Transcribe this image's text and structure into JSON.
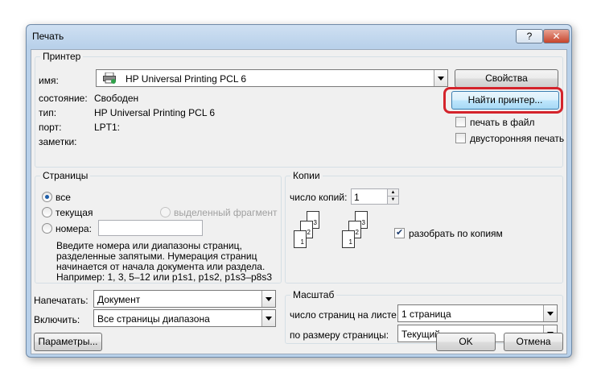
{
  "window": {
    "title": "Печать",
    "help_label": "?",
    "close_label": "✕"
  },
  "printer": {
    "group_title": "Принтер",
    "name_label": "имя:",
    "name_value": "HP Universal Printing PCL 6",
    "status_label": "состояние:",
    "status_value": "Свободен",
    "type_label": "тип:",
    "type_value": "HP Universal Printing PCL 6",
    "port_label": "порт:",
    "port_value": "LPT1:",
    "notes_label": "заметки:",
    "properties_button": "Свойства",
    "find_printer_button": "Найти принтер...",
    "print_to_file_label": "печать в файл",
    "print_to_file_checked": false,
    "duplex_label": "двусторонняя печать",
    "duplex_checked": false,
    "printer_icon": "printer-icon"
  },
  "pages": {
    "group_title": "Страницы",
    "all_label": "все",
    "current_label": "текущая",
    "selection_label": "выделенный фрагмент",
    "numbers_label": "номера:",
    "numbers_value": "",
    "selected_option": "все",
    "help_line1": "Введите номера или диапазоны страниц,",
    "help_line2": "разделенные запятыми. Нумерация страниц",
    "help_line3": "начинается от начала документа или раздела.",
    "help_line4": "Например: 1, 3, 5–12 или p1s1, p1s2, p1s3–p8s3"
  },
  "copies": {
    "group_title": "Копии",
    "count_label": "число копий:",
    "count_value": "1",
    "collate_label": "разобрать по копиям",
    "collate_checked": true,
    "sheet_numbers": [
      "1",
      "2",
      "3"
    ]
  },
  "print_what": {
    "label": "Напечатать:",
    "value": "Документ"
  },
  "include": {
    "label": "Включить:",
    "value": "Все страницы диапазона"
  },
  "zoom": {
    "group_title": "Масштаб",
    "pages_per_sheet_label": "число страниц на листе:",
    "pages_per_sheet_value": "1 страница",
    "scale_label": "по размеру страницы:",
    "scale_value": "Текущий"
  },
  "footer": {
    "options_button": "Параметры...",
    "ok_button": "OK",
    "cancel_button": "Отмена"
  },
  "colors": {
    "highlight": "#d4232b",
    "window_frame": "#b9d1ea",
    "dialog_bg": "#f0f0f0"
  }
}
